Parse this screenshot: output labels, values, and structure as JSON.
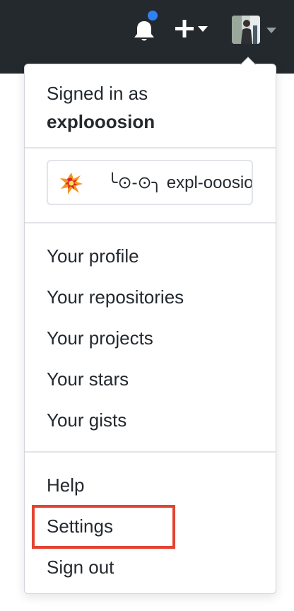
{
  "header": {
    "icons": {
      "notifications": "bell-icon",
      "create": "plus-icon",
      "caret": "caret-down-icon"
    },
    "notification_dot_color": "#2f81f7"
  },
  "dropdown": {
    "signed_in_prefix": "Signed in as",
    "username": "explooosion",
    "status": {
      "emoji": "collision-icon",
      "text": "╰⊙-⊙╮ expl-ooosion"
    },
    "menu": {
      "profile": "Your profile",
      "repositories": "Your repositories",
      "projects": "Your projects",
      "stars": "Your stars",
      "gists": "Your gists",
      "help": "Help",
      "settings": "Settings",
      "sign_out": "Sign out"
    },
    "highlight_color": "#e44332"
  }
}
